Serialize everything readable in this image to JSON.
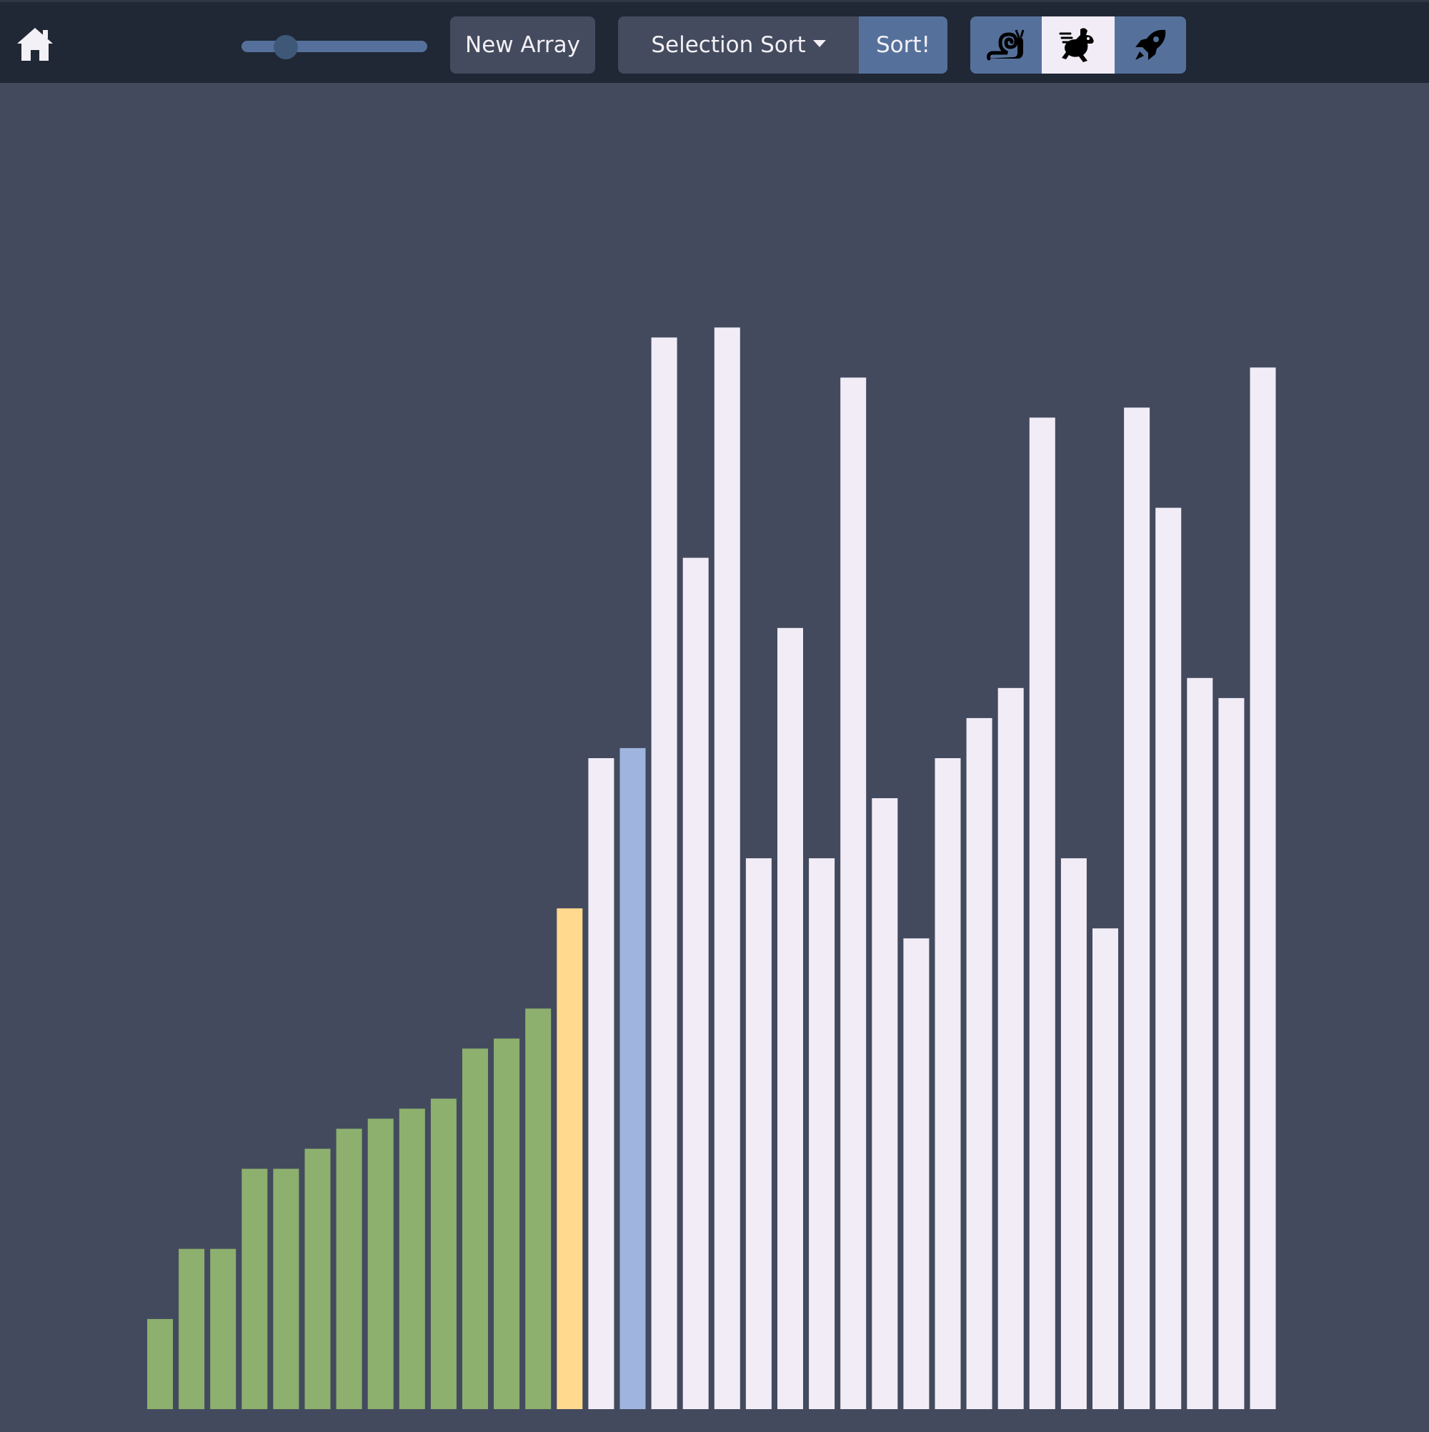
{
  "navbar": {
    "home_icon": "home-icon",
    "array_size_slider": {
      "value_fraction": 0.2
    },
    "new_array_label": "New Array",
    "algorithm_selected": "Selection Sort",
    "sort_label": "Sort!",
    "speed_options": [
      {
        "icon": "snail-icon",
        "active": false
      },
      {
        "icon": "rabbit-icon",
        "active": true
      },
      {
        "icon": "rocket-icon",
        "active": false
      }
    ]
  },
  "colors": {
    "background": "#434a5e",
    "navbar": "#1f2834",
    "accent": "#55719b",
    "sorted": "#8db06e",
    "current": "#fed98e",
    "compare": "#9fb5df",
    "unsorted": "#f1ecf6"
  },
  "chart_data": {
    "type": "bar",
    "values": [
      9,
      16,
      16,
      24,
      24,
      26,
      28,
      29,
      30,
      31,
      36,
      37,
      40,
      50,
      65,
      66,
      107,
      85,
      108,
      55,
      78,
      55,
      103,
      61,
      47,
      65,
      69,
      72,
      99,
      55,
      48,
      100,
      90,
      73,
      71,
      104
    ],
    "states": [
      "sorted",
      "sorted",
      "sorted",
      "sorted",
      "sorted",
      "sorted",
      "sorted",
      "sorted",
      "sorted",
      "sorted",
      "sorted",
      "sorted",
      "sorted",
      "current",
      "unsorted",
      "compare",
      "unsorted",
      "unsorted",
      "unsorted",
      "unsorted",
      "unsorted",
      "unsorted",
      "unsorted",
      "unsorted",
      "unsorted",
      "unsorted",
      "unsorted",
      "unsorted",
      "unsorted",
      "unsorted",
      "unsorted",
      "unsorted",
      "unsorted",
      "unsorted",
      "unsorted",
      "unsorted"
    ],
    "ylim": [
      0,
      125
    ]
  }
}
